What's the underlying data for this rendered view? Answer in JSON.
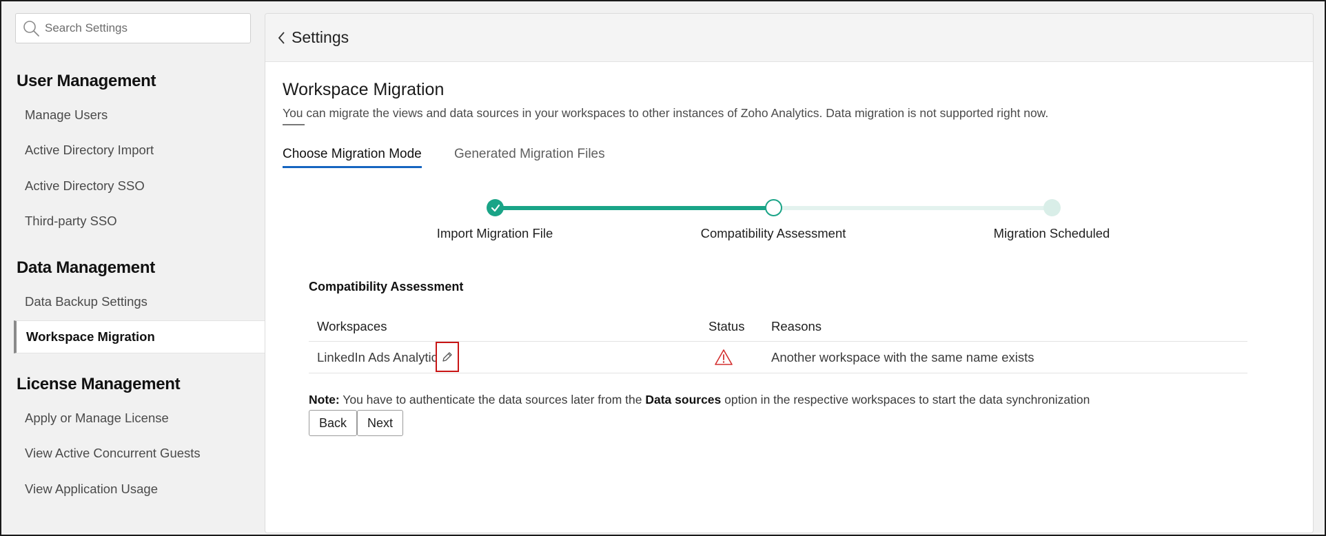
{
  "search": {
    "placeholder": "Search Settings"
  },
  "sidebar": {
    "sections": [
      {
        "title": "User Management",
        "items": [
          "Manage Users",
          "Active Directory Import",
          "Active Directory SSO",
          "Third-party SSO"
        ]
      },
      {
        "title": "Data Management",
        "items": [
          "Data Backup Settings",
          "Workspace Migration"
        ]
      },
      {
        "title": "License Management",
        "items": [
          "Apply or Manage License",
          "View Active Concurrent Guests",
          "View Application Usage"
        ]
      }
    ],
    "active_item": "Workspace Migration"
  },
  "header": {
    "title": "Settings"
  },
  "page": {
    "title": "Workspace Migration",
    "description": "You can migrate the views and data sources in your workspaces to other instances of Zoho Analytics. Data migration is not supported right now."
  },
  "tabs": [
    {
      "label": "Choose Migration Mode",
      "active": true
    },
    {
      "label": "Generated Migration Files",
      "active": false
    }
  ],
  "stepper": {
    "steps": [
      {
        "label": "Import Migration File",
        "state": "complete"
      },
      {
        "label": "Compatibility Assessment",
        "state": "current"
      },
      {
        "label": "Migration Scheduled",
        "state": "pending"
      }
    ],
    "accent_color": "#1aa487"
  },
  "assessment": {
    "title": "Compatibility Assessment",
    "columns": [
      "Workspaces",
      "Status",
      "Reasons"
    ],
    "rows": [
      {
        "workspace": "LinkedIn Ads Analytics",
        "status_icon": "warning-triangle-icon",
        "reason": "Another workspace with the same name exists"
      }
    ]
  },
  "note": {
    "prefix": "Note:",
    "text_before": " You have to authenticate the data sources later from the ",
    "bold": "Data sources",
    "text_after": " option in the respective workspaces to start the data synchronization"
  },
  "buttons": {
    "back": "Back",
    "next": "Next"
  },
  "colors": {
    "warning": "#d32f2f",
    "tab_underline": "#1565c0",
    "highlight_box": "#c81414"
  }
}
